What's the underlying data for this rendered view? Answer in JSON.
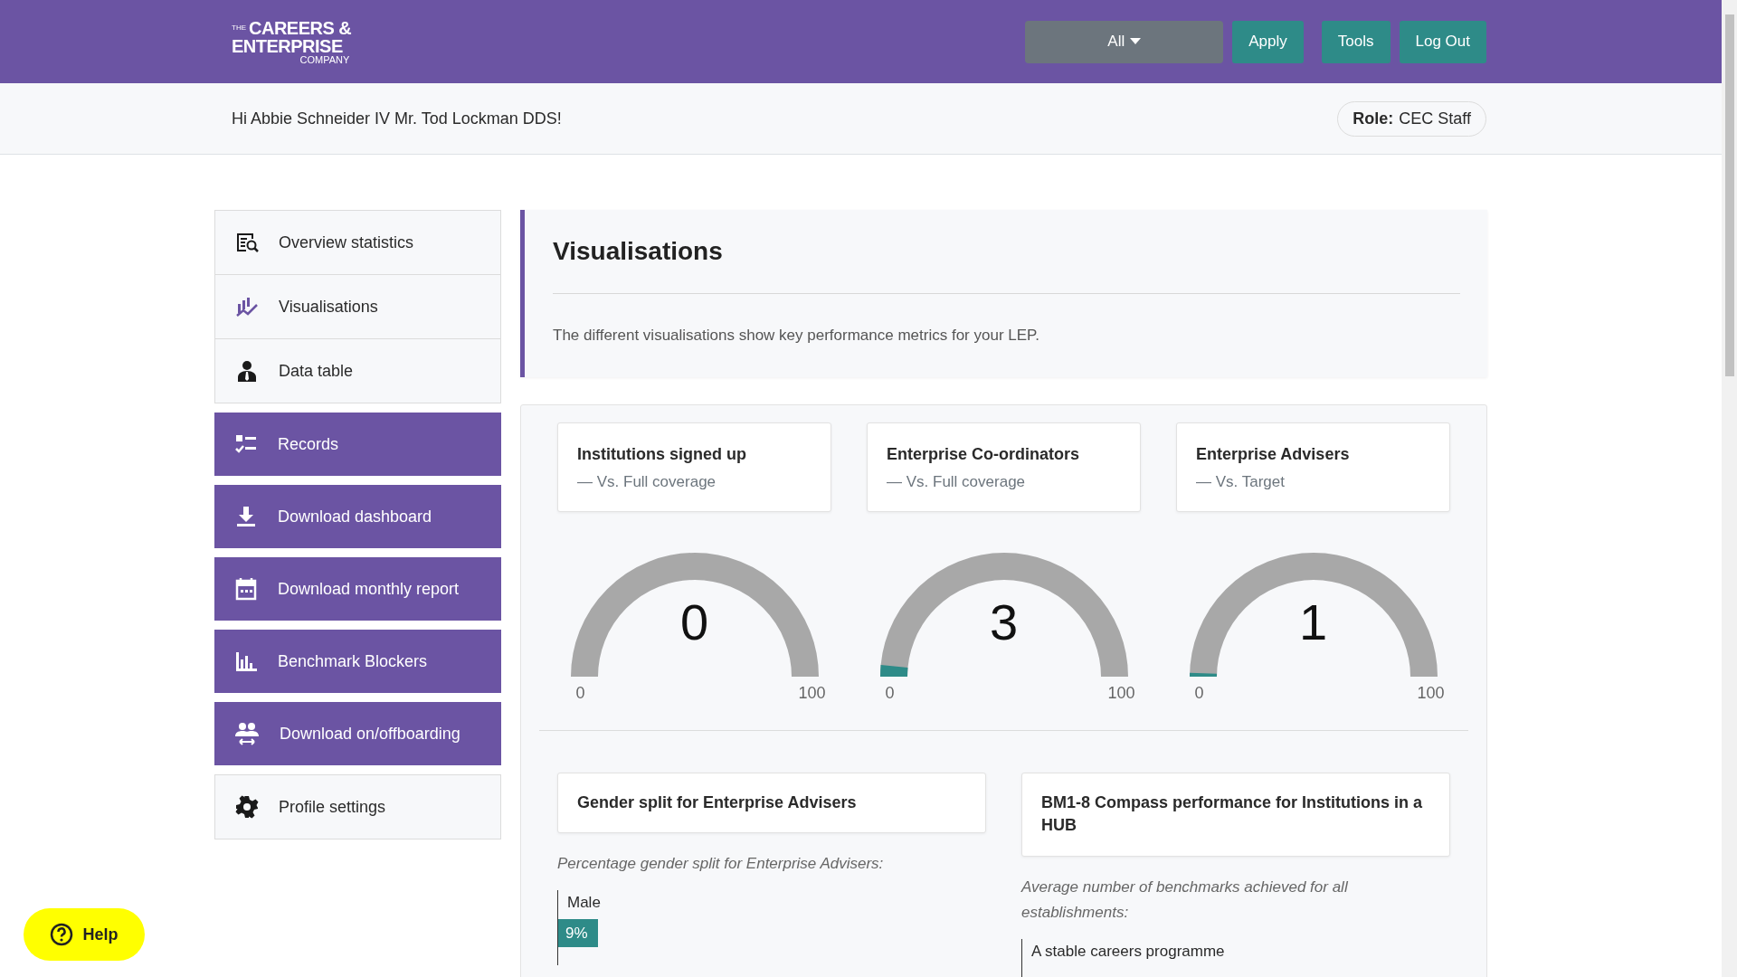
{
  "header": {
    "logo": {
      "small": "THE",
      "line1": "CAREERS &",
      "line2": "ENTERPRISE",
      "line3": "COMPANY"
    },
    "filter": {
      "label": "All"
    },
    "buttons": [
      "Apply",
      "Tools",
      "Log Out"
    ]
  },
  "subheader": {
    "greeting": "Hi Abbie Schneider IV Mr. Tod Lockman DDS!",
    "role_label": "Role:",
    "role": "CEC Staff"
  },
  "sidebar": {
    "items": [
      {
        "label": "Overview statistics",
        "kind": "nav",
        "selected": false
      },
      {
        "label": "Visualisations",
        "kind": "nav",
        "selected": true
      },
      {
        "label": "Data table",
        "kind": "nav",
        "selected": false
      },
      {
        "label": "Records",
        "kind": "action",
        "selected": false
      },
      {
        "label": "Download dashboard",
        "kind": "action",
        "selected": false
      },
      {
        "label": "Download monthly report",
        "kind": "action",
        "selected": false
      },
      {
        "label": "Benchmark Blockers",
        "kind": "action",
        "selected": false
      },
      {
        "label": "Download on/offboarding",
        "kind": "action",
        "selected": false
      },
      {
        "label": "Profile settings",
        "kind": "nav",
        "selected": false
      }
    ]
  },
  "intro": {
    "title": "Visualisations",
    "description": "The different visualisations show key performance metrics for your LEP."
  },
  "gauges": [
    {
      "title": "Institutions signed up",
      "subtitle": "— Vs. Full coverage",
      "value": "0",
      "level": 0,
      "min": "0",
      "max": "100"
    },
    {
      "title": "Enterprise Co-ordinators",
      "subtitle": "— Vs. Full coverage",
      "value": "3",
      "level": 0.03,
      "min": "0",
      "max": "100"
    },
    {
      "title": "Enterprise Advisers",
      "subtitle": "— Vs. Target",
      "value": "1",
      "level": 0.01,
      "min": "0",
      "max": "100"
    }
  ],
  "charts": [
    {
      "title": "Gender split for Enterprise Advisers",
      "description": "Percentage gender split for Enterprise Advisers:",
      "bars": [
        {
          "label": "Male",
          "value": "9%",
          "level": 0.09
        }
      ]
    },
    {
      "title": "BM1-8 Compass performance for Institutions in a HUB",
      "description": "Average number of benchmarks achieved for all establishments:",
      "bars": [
        {
          "label": "A stable careers programme"
        }
      ]
    }
  ],
  "help": {
    "label": "Help"
  }
}
